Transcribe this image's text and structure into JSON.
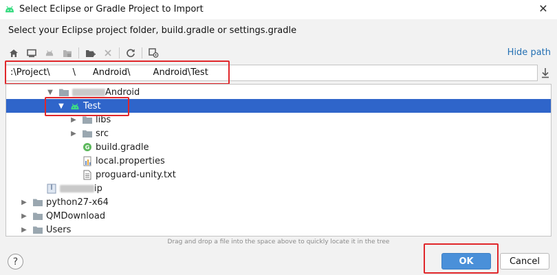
{
  "window": {
    "title": "Select Eclipse or Gradle Project to Import",
    "close_glyph": "✕"
  },
  "subtitle": "Select your Eclipse project folder, build.gradle or settings.gradle",
  "toolbar": {
    "icons": [
      "home-icon",
      "desktop-icon",
      "android-icon",
      "project-icon",
      "new-folder-icon",
      "delete-icon",
      "refresh-icon",
      "show-hidden-icon"
    ],
    "hide_path_label": "Hide path"
  },
  "path": {
    "value": ":\\Project\\        \\      Android\\        Android\\Test"
  },
  "tree": {
    "rows": [
      {
        "label": "Android",
        "level": 3,
        "arrow": "▼",
        "icon": "folder-icon",
        "selected": false,
        "blurred_prefix": true
      },
      {
        "label": "Test",
        "level": 4,
        "arrow": "▼",
        "icon": "android-icon",
        "selected": true,
        "blurred_prefix": false
      },
      {
        "label": "libs",
        "level": 5,
        "arrow": "▶",
        "icon": "folder-icon",
        "selected": false
      },
      {
        "label": "src",
        "level": 5,
        "arrow": "▶",
        "icon": "folder-icon",
        "selected": false
      },
      {
        "label": "build.gradle",
        "level": 5,
        "arrow": "",
        "icon": "gradle-file-icon",
        "selected": false
      },
      {
        "label": "local.properties",
        "level": 5,
        "arrow": "",
        "icon": "properties-file-icon",
        "selected": false
      },
      {
        "label": "proguard-unity.txt",
        "level": 5,
        "arrow": "",
        "icon": "text-file-icon",
        "selected": false
      },
      {
        "label": "ip",
        "level": 3,
        "arrow": "",
        "icon": "zip-file-icon",
        "selected": false,
        "blurred_prefix": true
      },
      {
        "label": "python27-x64",
        "level": 1,
        "arrow": "▶",
        "icon": "folder-icon",
        "selected": false
      },
      {
        "label": "QMDownload",
        "level": 1,
        "arrow": "▶",
        "icon": "folder-icon",
        "selected": false
      },
      {
        "label": "Users",
        "level": 1,
        "arrow": "▶",
        "icon": "folder-icon",
        "selected": false
      }
    ]
  },
  "hint": "Drag and drop a file into the space above to quickly locate it in the tree",
  "buttons": {
    "help": "?",
    "ok": "OK",
    "cancel": "Cancel"
  },
  "colors": {
    "selection": "#2f65ca",
    "accent_link": "#2470b3",
    "android_green": "#3ddc84",
    "annotation_red": "#e0262a",
    "ok_button": "#4a90d9"
  }
}
